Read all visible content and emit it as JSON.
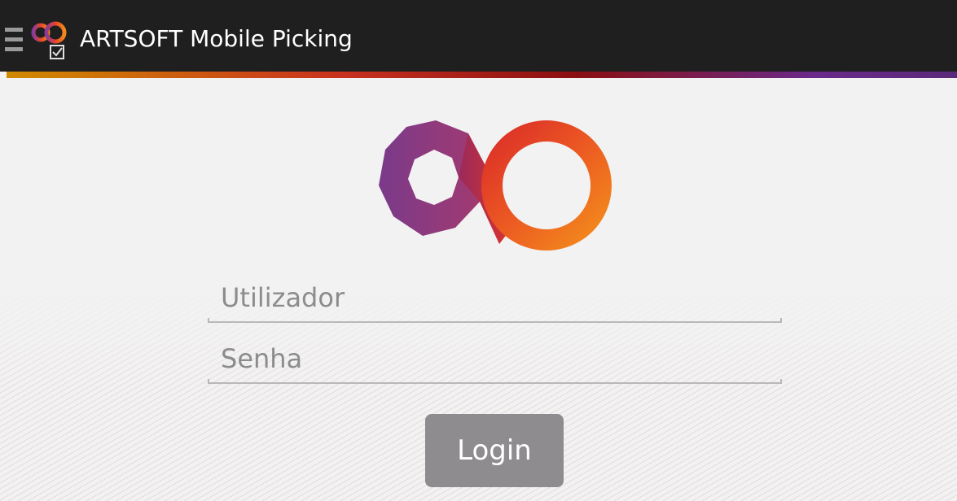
{
  "app": {
    "title": "ARTSOFT Mobile Picking"
  },
  "icons": {
    "menu": "menu-icon",
    "app_logo": "artsoft-logo-icon",
    "checkbox": "checkbox-icon",
    "hero_logo": "infinity-logo"
  },
  "colors": {
    "topbar": "#1f1f1f",
    "logo_purple": "#7a3a8a",
    "logo_red": "#e8442a",
    "logo_orange": "#f08a1a",
    "button": "#8e8c8e"
  },
  "login": {
    "username_placeholder": "Utilizador",
    "password_placeholder": "Senha",
    "button_label": "Login"
  }
}
